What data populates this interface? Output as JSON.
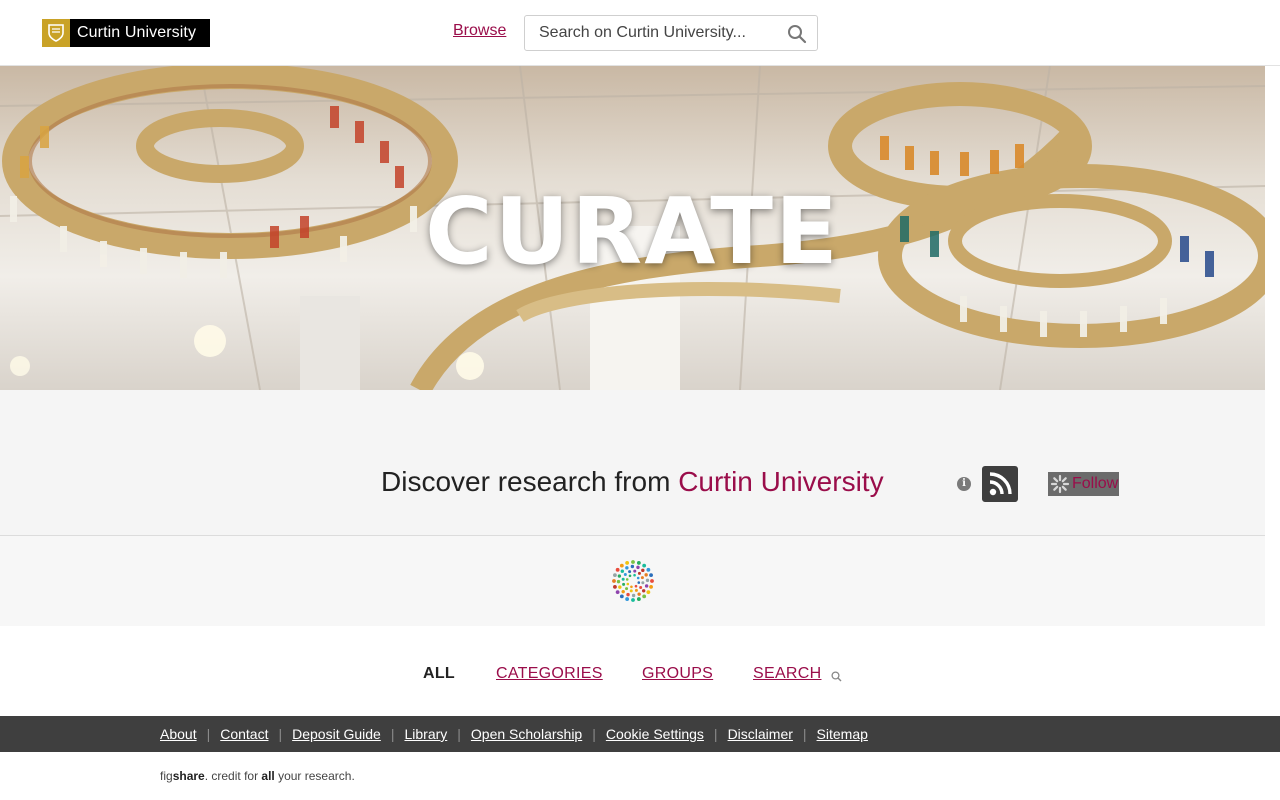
{
  "header": {
    "logo_text": "Curtin University",
    "browse_label": "Browse",
    "search_placeholder": "Search on Curtin University..."
  },
  "hero": {
    "title": "CURATE"
  },
  "discover": {
    "prefix": "Discover research from ",
    "institution": "Curtin University",
    "follow_label": "Follow"
  },
  "tabs": [
    {
      "label": "ALL",
      "active": true
    },
    {
      "label": "CATEGORIES",
      "active": false
    },
    {
      "label": "GROUPS",
      "active": false
    },
    {
      "label": "SEARCH",
      "active": false
    }
  ],
  "footer": {
    "links": [
      "About",
      "Contact",
      "Deposit Guide",
      "Library",
      "Open Scholarship",
      "Cookie Settings",
      "Disclaimer",
      "Sitemap"
    ],
    "credit": {
      "fig": "fig",
      "share": "share",
      "mid": ". credit for ",
      "all": "all",
      "end": " your research."
    }
  },
  "colors": {
    "accent": "#9a0d4a",
    "logo_gold": "#c9a227",
    "footer_bg": "#3f3f3f"
  },
  "icons": {
    "search": "search-icon",
    "info": "info-icon",
    "rss": "rss-icon",
    "loader": "figshare-loader-icon"
  }
}
